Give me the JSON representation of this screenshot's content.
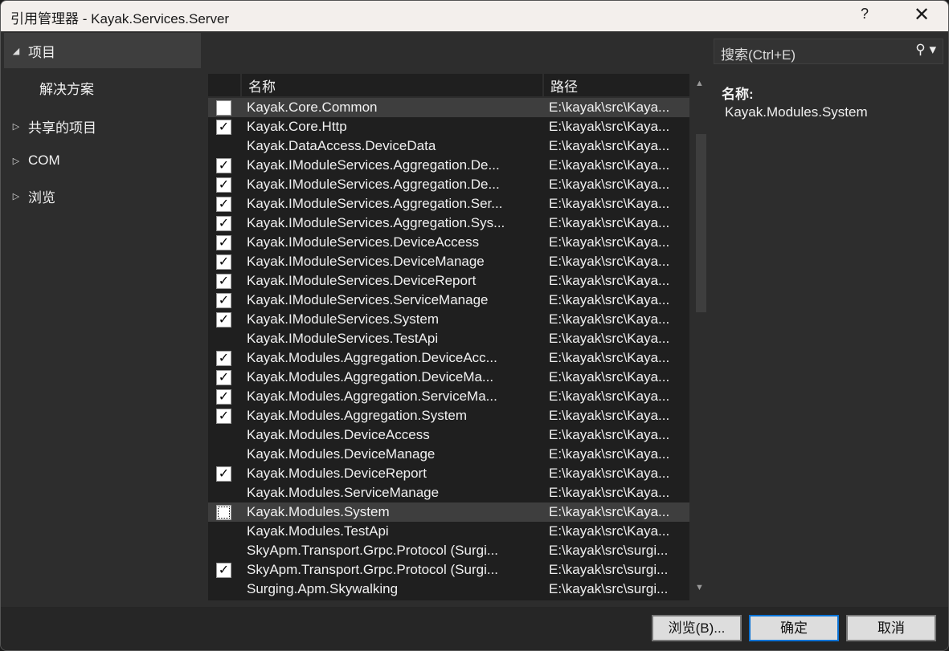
{
  "window": {
    "title": "引用管理器 - Kayak.Services.Server",
    "help": "?",
    "close": "✕"
  },
  "sidebar": {
    "items": [
      {
        "label": "项目",
        "arrow": "◢",
        "selected": true
      },
      {
        "label": "解决方案",
        "arrow": ""
      },
      {
        "label": "共享的项目",
        "arrow": "▷"
      },
      {
        "label": "COM",
        "arrow": "▷"
      },
      {
        "label": "浏览",
        "arrow": "▷"
      }
    ]
  },
  "search": {
    "placeholder": "搜索(Ctrl+E)",
    "icon": "search-icon"
  },
  "table": {
    "columns": [
      "名称",
      "路径"
    ],
    "rows": [
      {
        "name": "Kayak.Core.Common",
        "path": "E:\\kayak\\src\\Kaya...",
        "state": "unchecked",
        "hl": true
      },
      {
        "name": "Kayak.Core.Http",
        "path": "E:\\kayak\\src\\Kaya...",
        "state": "checked"
      },
      {
        "name": "Kayak.DataAccess.DeviceData",
        "path": "E:\\kayak\\src\\Kaya...",
        "state": "none"
      },
      {
        "name": "Kayak.IModuleServices.Aggregation.De...",
        "path": "E:\\kayak\\src\\Kaya...",
        "state": "checked"
      },
      {
        "name": "Kayak.IModuleServices.Aggregation.De...",
        "path": "E:\\kayak\\src\\Kaya...",
        "state": "checked"
      },
      {
        "name": "Kayak.IModuleServices.Aggregation.Ser...",
        "path": "E:\\kayak\\src\\Kaya...",
        "state": "checked"
      },
      {
        "name": "Kayak.IModuleServices.Aggregation.Sys...",
        "path": "E:\\kayak\\src\\Kaya...",
        "state": "checked"
      },
      {
        "name": "Kayak.IModuleServices.DeviceAccess",
        "path": "E:\\kayak\\src\\Kaya...",
        "state": "checked"
      },
      {
        "name": "Kayak.IModuleServices.DeviceManage",
        "path": "E:\\kayak\\src\\Kaya...",
        "state": "checked"
      },
      {
        "name": "Kayak.IModuleServices.DeviceReport",
        "path": "E:\\kayak\\src\\Kaya...",
        "state": "checked"
      },
      {
        "name": "Kayak.IModuleServices.ServiceManage",
        "path": "E:\\kayak\\src\\Kaya...",
        "state": "checked"
      },
      {
        "name": "Kayak.IModuleServices.System",
        "path": "E:\\kayak\\src\\Kaya...",
        "state": "checked"
      },
      {
        "name": "Kayak.IModuleServices.TestApi",
        "path": "E:\\kayak\\src\\Kaya...",
        "state": "none"
      },
      {
        "name": "Kayak.Modules.Aggregation.DeviceAcc...",
        "path": "E:\\kayak\\src\\Kaya...",
        "state": "checked"
      },
      {
        "name": "Kayak.Modules.Aggregation.DeviceMa...",
        "path": "E:\\kayak\\src\\Kaya...",
        "state": "checked"
      },
      {
        "name": "Kayak.Modules.Aggregation.ServiceMa...",
        "path": "E:\\kayak\\src\\Kaya...",
        "state": "checked"
      },
      {
        "name": "Kayak.Modules.Aggregation.System",
        "path": "E:\\kayak\\src\\Kaya...",
        "state": "checked"
      },
      {
        "name": "Kayak.Modules.DeviceAccess",
        "path": "E:\\kayak\\src\\Kaya...",
        "state": "none"
      },
      {
        "name": "Kayak.Modules.DeviceManage",
        "path": "E:\\kayak\\src\\Kaya...",
        "state": "none"
      },
      {
        "name": "Kayak.Modules.DeviceReport",
        "path": "E:\\kayak\\src\\Kaya...",
        "state": "checked"
      },
      {
        "name": "Kayak.Modules.ServiceManage",
        "path": "E:\\kayak\\src\\Kaya...",
        "state": "none"
      },
      {
        "name": "Kayak.Modules.System",
        "path": "E:\\kayak\\src\\Kaya...",
        "state": "focused",
        "hl": true
      },
      {
        "name": "Kayak.Modules.TestApi",
        "path": "E:\\kayak\\src\\Kaya...",
        "state": "none"
      },
      {
        "name": "SkyApm.Transport.Grpc.Protocol (Surgi...",
        "path": "E:\\kayak\\src\\surgi...",
        "state": "none"
      },
      {
        "name": "SkyApm.Transport.Grpc.Protocol (Surgi...",
        "path": "E:\\kayak\\src\\surgi...",
        "state": "checked"
      },
      {
        "name": "Surging.Apm.Skywalking",
        "path": "E:\\kayak\\src\\surgi...",
        "state": "none"
      }
    ]
  },
  "detail": {
    "label": "名称:",
    "value": "Kayak.Modules.System"
  },
  "buttons": {
    "browse": "浏览(B)...",
    "ok": "确定",
    "cancel": "取消"
  },
  "colors": {
    "accent": "#0a73d6",
    "selected_row": "#3e3e3e"
  }
}
